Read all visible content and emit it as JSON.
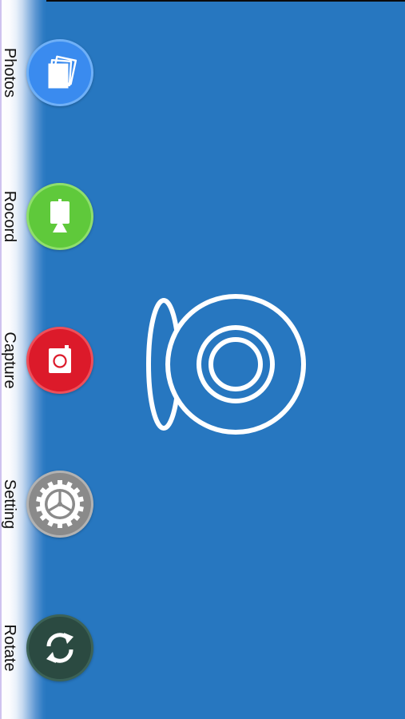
{
  "sidebar": {
    "items": [
      {
        "label": "Photos",
        "icon": "photos-icon",
        "color": "#3a8bef"
      },
      {
        "label": "Rocord",
        "icon": "record-icon",
        "color": "#5fc93b"
      },
      {
        "label": "Capture",
        "icon": "capture-icon",
        "color": "#dc1a2a"
      },
      {
        "label": "Setting",
        "icon": "gear-icon",
        "color": "#8a8a8a"
      },
      {
        "label": "Rotate",
        "icon": "rotate-icon",
        "color": "#2b4a41"
      }
    ]
  },
  "main": {
    "background_color": "#2777c0",
    "logo_icon": "webcam-icon"
  }
}
